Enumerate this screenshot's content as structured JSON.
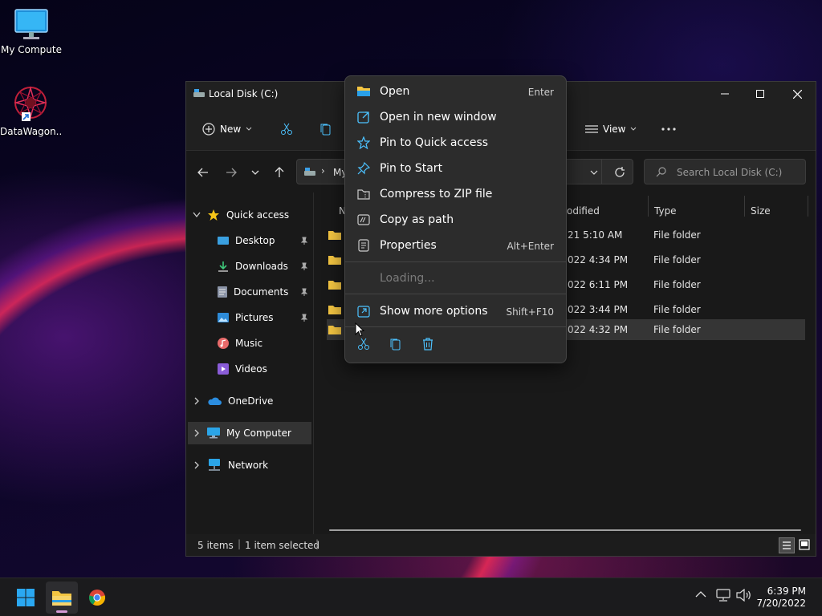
{
  "desktop": {
    "icons": [
      {
        "label": "My Computer"
      },
      {
        "label": "DataWagon..."
      }
    ]
  },
  "window": {
    "title": "Local Disk (C:)",
    "commandbar": {
      "new_label": "New",
      "view_label": "View"
    },
    "address": {
      "crumb": "My"
    },
    "search": {
      "placeholder": "Search Local Disk (C:)"
    },
    "navpane": {
      "quick_access": "Quick access",
      "items": [
        {
          "label": "Desktop",
          "pinned": true
        },
        {
          "label": "Downloads",
          "pinned": true
        },
        {
          "label": "Documents",
          "pinned": true
        },
        {
          "label": "Pictures",
          "pinned": true
        },
        {
          "label": "Music",
          "pinned": false
        },
        {
          "label": "Videos",
          "pinned": false
        }
      ],
      "onedrive": "OneDrive",
      "my_computer": "My Computer",
      "network": "Network"
    },
    "columns": {
      "name": "N",
      "modified": "odified",
      "type": "Type",
      "size": "Size"
    },
    "rows": [
      {
        "date": "21 5:10 AM",
        "type": "File folder",
        "selected": false
      },
      {
        "date": "022 4:34 PM",
        "type": "File folder",
        "selected": false
      },
      {
        "date": "022 6:11 PM",
        "type": "File folder",
        "selected": false
      },
      {
        "date": "022 3:44 PM",
        "type": "File folder",
        "selected": false
      },
      {
        "date": "022 4:32 PM",
        "type": "File folder",
        "selected": true
      }
    ],
    "status": {
      "items": "5 items",
      "selected": "1 item selected"
    }
  },
  "context_menu": {
    "items": [
      {
        "label": "Open",
        "shortcut": "Enter",
        "icon": "folder-open-icon"
      },
      {
        "label": "Open in new window",
        "shortcut": "",
        "icon": "new-window-icon"
      },
      {
        "label": "Pin to Quick access",
        "shortcut": "",
        "icon": "star-icon"
      },
      {
        "label": "Pin to Start",
        "shortcut": "",
        "icon": "pin-icon"
      },
      {
        "label": "Compress to ZIP file",
        "shortcut": "",
        "icon": "zip-icon"
      },
      {
        "label": "Copy as path",
        "shortcut": "",
        "icon": "copy-path-icon"
      },
      {
        "label": "Properties",
        "shortcut": "Alt+Enter",
        "icon": "properties-icon"
      }
    ],
    "loading": "Loading...",
    "more": {
      "label": "Show more options",
      "shortcut": "Shift+F10"
    }
  },
  "taskbar": {
    "time": "6:39 PM",
    "date": "7/20/2022"
  },
  "colors": {
    "accent": "#4cc2ff",
    "folder": "#f4c542",
    "menu_bg": "#2c2c2c",
    "window_bg": "#191919"
  }
}
